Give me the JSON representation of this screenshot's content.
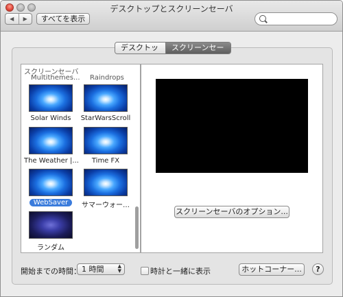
{
  "window": {
    "title": "デスクトップとスクリーンセーバ",
    "nav_back": "◀",
    "nav_forward": "▶",
    "show_all": "すべてを表示",
    "search_placeholder": ""
  },
  "tabs": [
    {
      "label": "デスクトップ",
      "active": false
    },
    {
      "label": "スクリーンセーバ",
      "active": true
    }
  ],
  "list": {
    "header": "スクリーンセーバ",
    "clipped_top": [
      "Multithemes...",
      "Raindrops"
    ],
    "items": [
      {
        "label": "Solar Winds",
        "thumb": "blue-swirl",
        "selected": false
      },
      {
        "label": "StarWarsScroll",
        "thumb": "blue-swirl",
        "selected": false
      },
      {
        "label": "The Weather |...",
        "thumb": "blue-swirl",
        "selected": false
      },
      {
        "label": "Time FX",
        "thumb": "blue-swirl",
        "selected": false
      },
      {
        "label": "WebSaver",
        "thumb": "blue-swirl",
        "selected": true
      },
      {
        "label": "サマーウォー…",
        "thumb": "blue-swirl",
        "selected": false
      },
      {
        "label": "ランダム",
        "thumb": "dark-swirl",
        "selected": false
      }
    ]
  },
  "preview": {
    "options_button": "スクリーンセーバのオプション..."
  },
  "footer": {
    "start_label": "開始までの時間：",
    "start_value": "1 時間",
    "clock_checkbox_label": "時計と一緒に表示",
    "clock_checked": false,
    "hot_corners_button": "ホットコーナー...",
    "help_button": "?"
  }
}
